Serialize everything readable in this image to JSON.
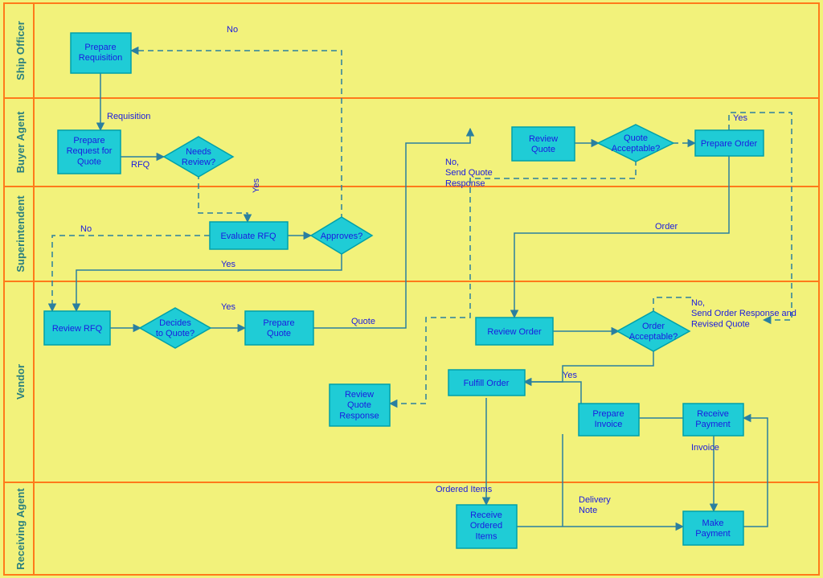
{
  "lanes": {
    "ship_officer": "Ship Officer",
    "buyer_agent": "Buyer Agent",
    "superintendent": "Superintendent",
    "vendor": "Vendor",
    "receiving_agent": "Receiving Agent"
  },
  "nodes": {
    "prepare_requisition": "Prepare\nRequisition",
    "prepare_rfq": "Prepare\nRequest for\nQuote",
    "needs_review": "Needs\nReview?",
    "evaluate_rfq": "Evaluate RFQ",
    "approves": "Approves?",
    "review_rfq": "Review RFQ",
    "decides_to_quote": "Decides\nto Quote?",
    "prepare_quote": "Prepare\nQuote",
    "review_quote": "Review\nQuote",
    "quote_acceptable": "Quote\nAcceptable?",
    "prepare_order": "Prepare Order",
    "review_quote_response": "Review\nQuote\nResponse",
    "review_order": "Review Order",
    "order_acceptable": "Order\nAcceptable?",
    "fulfill_order": "Fulfill Order",
    "prepare_invoice": "Prepare\nInvoice",
    "receive_payment": "Receive\nPayment",
    "receive_ordered_items": "Receive\nOrdered\nItems",
    "make_payment": "Make\nPayment"
  },
  "edges": {
    "requisition": "Requisition",
    "rfq": "RFQ",
    "no1": "No",
    "yes1": "Yes",
    "yes2": "Yes",
    "no2": "No",
    "yes_quote": "Yes",
    "quote": "Quote",
    "no_send_quote": "No,\nSend Quote\nResponse",
    "yes_qa": "Yes",
    "order": "Order",
    "no_order": "No,\nSend Order Response and\nRevised Quote",
    "yes_oa": "Yes",
    "ordered_items": "Ordered Items",
    "delivery_note": "Delivery\nNote",
    "invoice": "Invoice"
  }
}
